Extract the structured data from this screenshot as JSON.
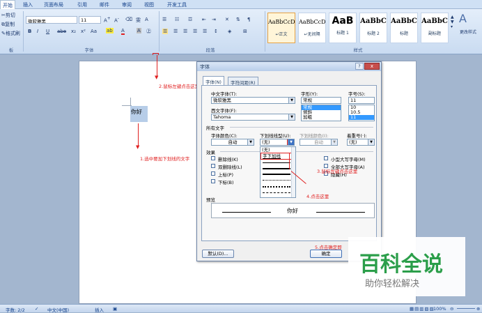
{
  "ribbon": {
    "tabs": [
      "开始",
      "插入",
      "页面布局",
      "引用",
      "邮件",
      "审阅",
      "视图",
      "开发工具"
    ],
    "clipboard": {
      "cut": "剪切",
      "copy": "复制",
      "format_painter": "格式刷"
    },
    "font": {
      "name": "微软雅黑",
      "size": "11",
      "group_label": "字体"
    },
    "paragraph": {
      "group_label": "段落"
    },
    "styles": {
      "group_label": "样式",
      "items": [
        {
          "preview": "AaBbCcD",
          "name": "↵正文",
          "selected": true
        },
        {
          "preview": "AaBbCcD",
          "name": "↵无间隔",
          "selected": false
        },
        {
          "preview": "AaB",
          "name": "标题 1",
          "selected": false
        },
        {
          "preview": "AaBbC",
          "name": "标题 2",
          "selected": false
        },
        {
          "preview": "AaBbC",
          "name": "标题",
          "selected": false
        },
        {
          "preview": "AaBbC",
          "name": "副标题",
          "selected": false
        }
      ],
      "change_styles": "更改样式"
    }
  },
  "document": {
    "selected_text": "你好"
  },
  "annotations": {
    "step1": "1.选中要加下划线的文字",
    "step2": "2.鼠标左键点击这里",
    "step3": "3.鼠标左键点击这里",
    "step4": "4.点击这里",
    "step5": "5.点击确定即"
  },
  "dialog": {
    "title": "字体",
    "help": "?",
    "close": "x",
    "tabs": [
      "字体(N)",
      "字符间距(R)"
    ],
    "chinese_font_label": "中文字体(T):",
    "chinese_font_value": "微软雅黑",
    "western_font_label": "西文字体(F):",
    "western_font_value": "Tahoma",
    "style_label": "字形(Y):",
    "style_value": "常规",
    "style_options": [
      "常规",
      "倾斜",
      "加粗"
    ],
    "size_label": "字号(S):",
    "size_value": "11",
    "size_options": [
      "10",
      "10.5",
      "11"
    ],
    "all_text_label": "所有文字",
    "font_color_label": "字体颜色(C):",
    "font_color_value": "自动",
    "underline_style_label": "下划线线型(U):",
    "underline_style_value": "(无)",
    "underline_color_label": "下划线颜色(I):",
    "underline_color_value": "自动",
    "emphasis_label": "着重号(·):",
    "emphasis_value": "(无)",
    "underline_options": [
      "(无)",
      "字下加线"
    ],
    "effects_label": "效果",
    "effects_left": [
      "删除线(K)",
      "双删除线(L)",
      "上标(P)",
      "下标(B)"
    ],
    "effects_right": [
      "小型大写字母(M)",
      "全部大写字母(A)",
      "隐藏(H)"
    ],
    "preview_label": "预览",
    "preview_text": "你好",
    "default_button": "默认(D)...",
    "ok_button": "确定"
  },
  "status_bar": {
    "word_count": "字数: 2/2",
    "language": "中文(中国)",
    "mode": "插入",
    "zoom": "100%"
  },
  "watermark": {
    "title": "百科全说",
    "subtitle": "助你轻松解决"
  }
}
